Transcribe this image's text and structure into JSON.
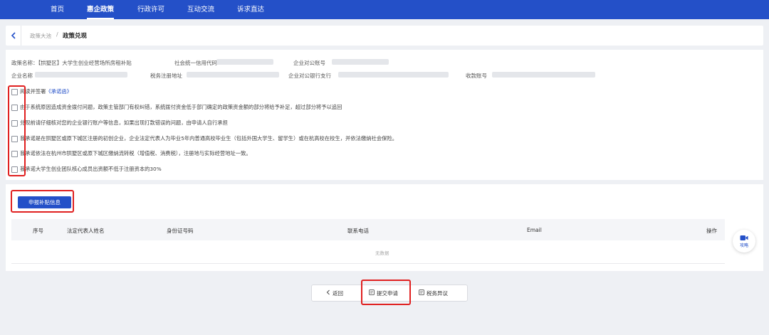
{
  "nav": {
    "items": [
      "首页",
      "惠企政策",
      "行政许可",
      "互动交流",
      "诉求直达"
    ],
    "active_index": 1
  },
  "breadcrumb": {
    "parent": "政策大池",
    "separator": "/",
    "current": "政策兑现"
  },
  "info": {
    "policy_name": "政策名称：【拱墅区】大学生创业经营场所房租补贴",
    "credit_code_label": "社会统一信用代码",
    "corp_account_label": "企业对公账号",
    "company_name_label": "企业名称",
    "tax_address_label": "税务注册地址",
    "corp_bank_label": "企业对公银行支行",
    "receive_account_label": "收款账号"
  },
  "commitments": [
    {
      "text": "阅读并签署",
      "link": "《承诺函》"
    },
    {
      "text": "由于系统原因造成资金拨付问题，政策主管部门有权纠错，系统拨付资金低于部门确定的政策资金额的部分将给予补足，超过部分将予以追回"
    },
    {
      "text": "兑现前请仔细核对您的企业银行账户等信息，如果出现打款错误的问题，由申请人自行承担"
    },
    {
      "text": "我承诺是在拱墅区或原下城区注册的初创企业，企业法定代表人为毕业5年内普通高校毕业生（包括外国大学生、留学生）或在杭高校在校生，并依法缴纳社会保险。"
    },
    {
      "text": "我承诺依法在杭州市拱墅区或原下城区缴纳流转税（增值税、消费税），注册地与实际经营地址一致。"
    },
    {
      "text": "我承诺大学生创业团队核心成员出资额不低于注册资本的30%"
    }
  ],
  "apply_button": "申报补贴信息",
  "table": {
    "headers": [
      "序号",
      "法定代表人姓名",
      "身份证号码",
      "联系电话",
      "Email",
      "操作"
    ],
    "empty_text": "无数据"
  },
  "guide": {
    "label": "攻略",
    "icon": "video-camera-icon"
  },
  "footer": {
    "back": "返回",
    "submit": "提交申请",
    "tax_objection": "税务异议"
  },
  "colors": {
    "brand": "#2450c8",
    "highlight": "#e02020"
  }
}
